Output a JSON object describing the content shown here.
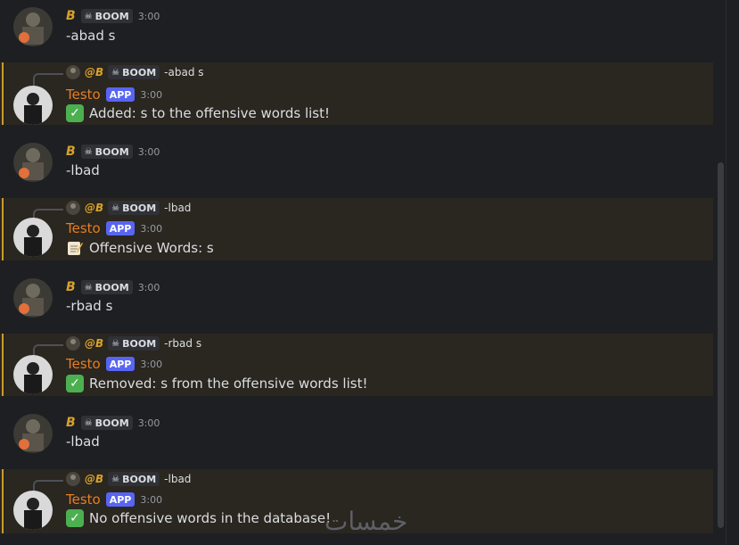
{
  "messages": [
    {
      "kind": "user",
      "name": "B",
      "tag": "BOOM",
      "time": "3:00",
      "text": "-abad s"
    },
    {
      "kind": "bot",
      "reply": {
        "name": "@B",
        "tag": "BOOM",
        "text": "-abad s"
      },
      "name": "Testo",
      "badge": "APP",
      "time": "3:00",
      "emoji": "check",
      "text": "Added: s to the offensive words list!"
    },
    {
      "kind": "user",
      "name": "B",
      "tag": "BOOM",
      "time": "3:00",
      "text": "-lbad"
    },
    {
      "kind": "bot",
      "reply": {
        "name": "@B",
        "tag": "BOOM",
        "text": "-lbad"
      },
      "name": "Testo",
      "badge": "APP",
      "time": "3:00",
      "emoji": "memo",
      "text": "Offensive Words: s"
    },
    {
      "kind": "user",
      "name": "B",
      "tag": "BOOM",
      "time": "3:00",
      "text": "-rbad s"
    },
    {
      "kind": "bot",
      "reply": {
        "name": "@B",
        "tag": "BOOM",
        "text": "-rbad s"
      },
      "name": "Testo",
      "badge": "APP",
      "time": "3:00",
      "emoji": "check",
      "text": "Removed: s from the offensive words list!"
    },
    {
      "kind": "user",
      "name": "B",
      "tag": "BOOM",
      "time": "3:00",
      "text": "-lbad"
    },
    {
      "kind": "bot",
      "reply": {
        "name": "@B",
        "tag": "BOOM",
        "text": "-lbad"
      },
      "name": "Testo",
      "badge": "APP",
      "time": "3:00",
      "emoji": "check",
      "text": "No offensive words in the database!"
    }
  ],
  "watermark": "خمسات",
  "colors": {
    "background": "#1e1f22",
    "mention_bg": "#2a2620",
    "mention_bar": "#c99c2e",
    "user_name": "#d6a12b",
    "bot_name": "#e67e22",
    "app_badge": "#5865f2"
  }
}
